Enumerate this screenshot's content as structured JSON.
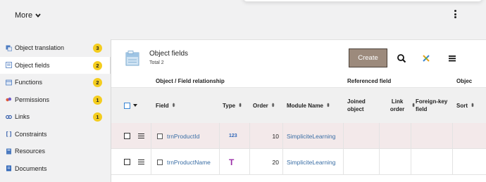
{
  "header": {
    "more_label": "More"
  },
  "sidebar": {
    "items": [
      {
        "label": "Object translation",
        "badge": "3",
        "icon": "translate-icon"
      },
      {
        "label": "Object fields",
        "badge": "2",
        "icon": "list-icon",
        "active": true
      },
      {
        "label": "Functions",
        "badge": "2",
        "icon": "functions-icon"
      },
      {
        "label": "Permissions",
        "badge": "1",
        "icon": "permissions-icon"
      },
      {
        "label": "Links",
        "badge": "1",
        "icon": "links-icon"
      },
      {
        "label": "Constraints",
        "icon": "constraints-icon"
      },
      {
        "label": "Resources",
        "icon": "resources-icon"
      },
      {
        "label": "Documents",
        "icon": "documents-icon"
      }
    ]
  },
  "panel": {
    "title": "Object fields",
    "subtitle": "Total 2",
    "create_label": "Create"
  },
  "table": {
    "groups": {
      "object_field": "Object / Field relationship",
      "referenced": "Referenced field",
      "object": "Objec"
    },
    "columns": {
      "field": "Field",
      "type": "Type",
      "order": "Order",
      "module": "Module Name",
      "joined": "Joined object",
      "link_order": "Link order",
      "foreign_key": "Foreign-key field",
      "sort": "Sort"
    },
    "rows": [
      {
        "field": "trnProductId",
        "type_label": "123",
        "order": "10",
        "module": "SimpliciteLearning"
      },
      {
        "field": "trnProductName",
        "type_label": "T",
        "order": "20",
        "module": "SimpliciteLearning"
      }
    ]
  },
  "colors": {
    "badge": "#f4cd1f",
    "create_button": "#9c8a7c",
    "link": "#3a6ea5",
    "selected_row": "#f3e9ea"
  }
}
